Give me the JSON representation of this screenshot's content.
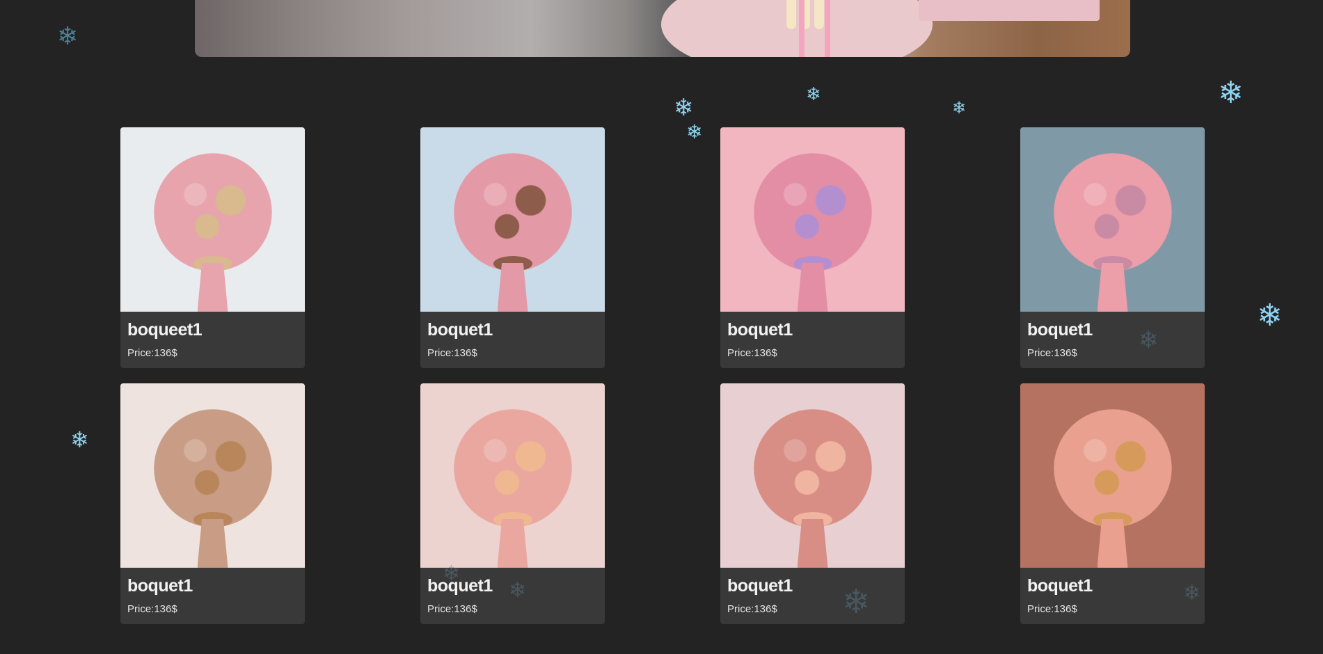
{
  "products": [
    {
      "name": "boqueet1",
      "price_label": "Price:136$",
      "bg": "#e9ecef",
      "bouquet_color": "#e7a4ad",
      "accent": "#d9b98e"
    },
    {
      "name": "boquet1",
      "price_label": "Price:136$",
      "bg": "#c9dbe8",
      "bouquet_color": "#e49aa6",
      "accent": "#8e5c4a"
    },
    {
      "name": "boquet1",
      "price_label": "Price:136$",
      "bg": "#f1b6bf",
      "bouquet_color": "#e48ea6",
      "accent": "#b48fd0"
    },
    {
      "name": "boquet1",
      "price_label": "Price:136$",
      "bg": "#7f9aa6",
      "bouquet_color": "#ec9ea9",
      "accent": "#c98aa3"
    },
    {
      "name": "boquet1",
      "price_label": "Price:136$",
      "bg": "#eee3df",
      "bouquet_color": "#c99c85",
      "accent": "#b8865a"
    },
    {
      "name": "boquet1",
      "price_label": "Price:136$",
      "bg": "#ecd3cf",
      "bouquet_color": "#e9a7a0",
      "accent": "#f0b890"
    },
    {
      "name": "boquet1",
      "price_label": "Price:136$",
      "bg": "#e7cfd2",
      "bouquet_color": "#d88d85",
      "accent": "#efb5a0"
    },
    {
      "name": "boquet1",
      "price_label": "Price:136$",
      "bg": "#b57260",
      "bouquet_color": "#e9a08f",
      "accent": "#d69a5a"
    }
  ],
  "decor": {
    "snowflake_icon": "❄",
    "snowflake_color": "#8fd3f2"
  }
}
